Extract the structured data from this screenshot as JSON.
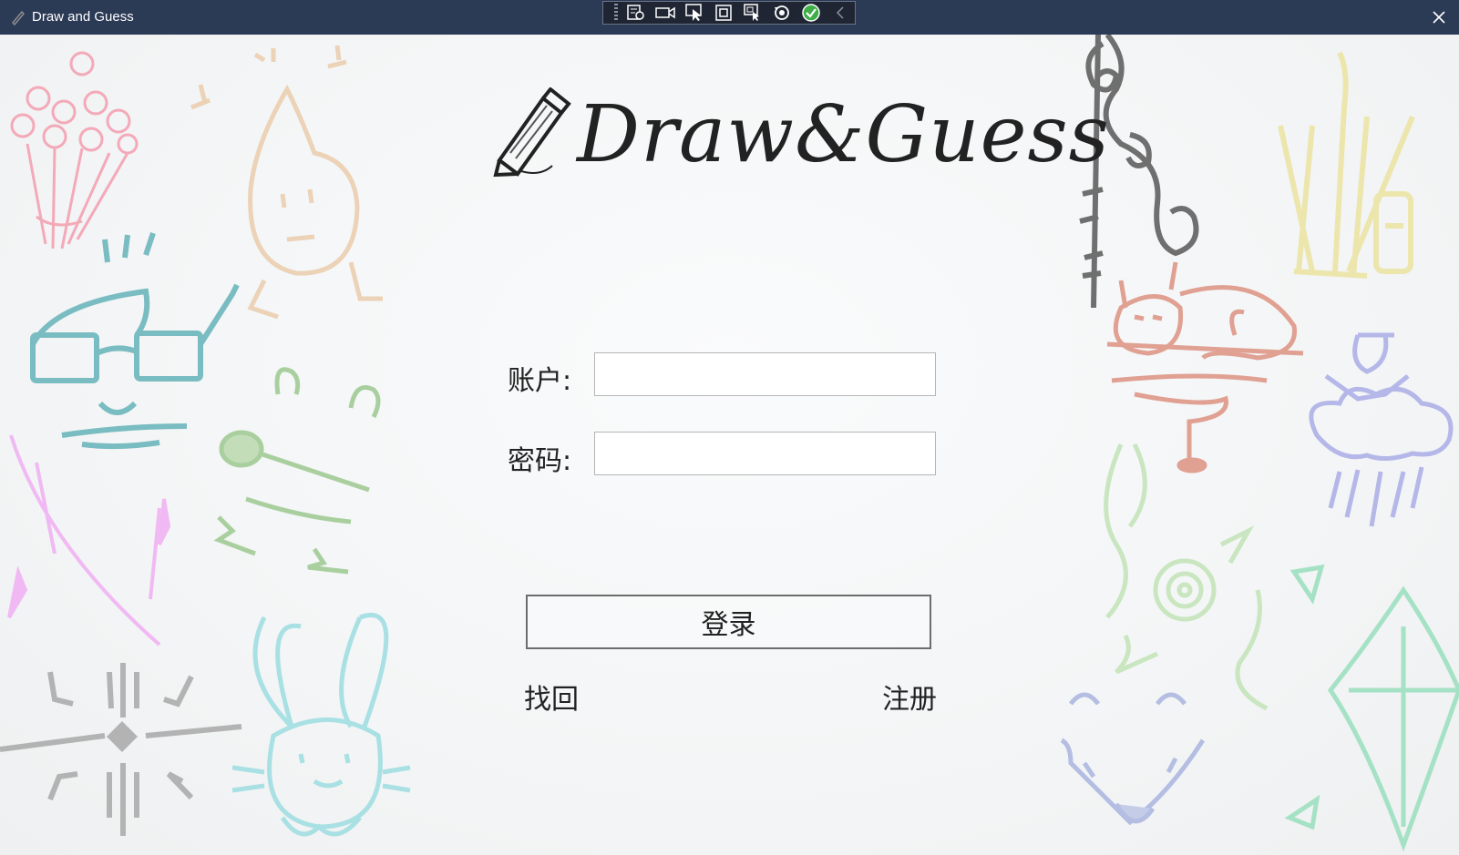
{
  "window": {
    "title": "Draw and Guess",
    "icon": "pen-icon",
    "close_icon": "close-icon"
  },
  "debug_toolbar": {
    "buttons": [
      {
        "icon": "live-visual-tree-icon"
      },
      {
        "icon": "record-icon"
      },
      {
        "icon": "select-element-icon"
      },
      {
        "icon": "display-layout-adorners-icon"
      },
      {
        "icon": "track-focus-icon"
      },
      {
        "icon": "hot-reload-icon"
      },
      {
        "icon": "status-ok-icon"
      },
      {
        "icon": "collapse-chevron-icon"
      }
    ],
    "status_color": "#3fae49"
  },
  "logo": {
    "text": "Draw&Guess",
    "icon": "pencil-icon"
  },
  "form": {
    "account_label": "账户:",
    "account_value": "",
    "password_label": "密码:",
    "password_value": ""
  },
  "actions": {
    "login": "登录",
    "recover": "找回",
    "register": "注册"
  },
  "colors": {
    "titlebar": "#2b3a55",
    "background": "#f4f5f5"
  }
}
